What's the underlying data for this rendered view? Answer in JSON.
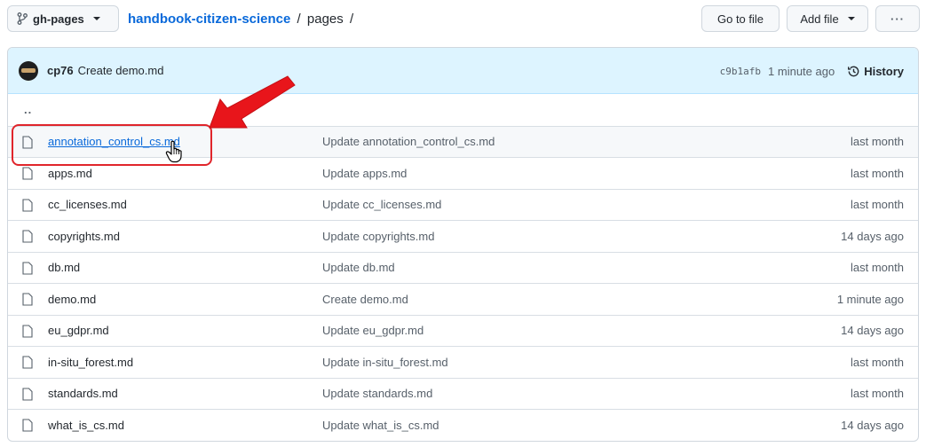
{
  "topbar": {
    "branch": "gh-pages",
    "breadcrumb_repo": "handbook-citizen-science",
    "breadcrumb_sep": "/",
    "breadcrumb_dir": "pages",
    "breadcrumb_trail": "/",
    "goto_file": "Go to file",
    "add_file": "Add file",
    "more": "···"
  },
  "commit": {
    "author": "cp76",
    "message": "Create demo.md",
    "sha": "c9b1afb",
    "time": "1 minute ago",
    "history_label": "History"
  },
  "parent_dir": "..",
  "files": [
    {
      "name": "annotation_control_cs.md",
      "message": "Update annotation_control_cs.md",
      "age": "last month"
    },
    {
      "name": "apps.md",
      "message": "Update apps.md",
      "age": "last month"
    },
    {
      "name": "cc_licenses.md",
      "message": "Update cc_licenses.md",
      "age": "last month"
    },
    {
      "name": "copyrights.md",
      "message": "Update copyrights.md",
      "age": "14 days ago"
    },
    {
      "name": "db.md",
      "message": "Update db.md",
      "age": "last month"
    },
    {
      "name": "demo.md",
      "message": "Create demo.md",
      "age": "1 minute ago"
    },
    {
      "name": "eu_gdpr.md",
      "message": "Update eu_gdpr.md",
      "age": "14 days ago"
    },
    {
      "name": "in-situ_forest.md",
      "message": "Update in-situ_forest.md",
      "age": "last month"
    },
    {
      "name": "standards.md",
      "message": "Update standards.md",
      "age": "last month"
    },
    {
      "name": "what_is_cs.md",
      "message": "Update what_is_cs.md",
      "age": "14 days ago"
    }
  ],
  "colors": {
    "accent_link": "#0969da",
    "annotation_red": "#e0252b",
    "commit_bar_bg": "#ddf4ff"
  }
}
